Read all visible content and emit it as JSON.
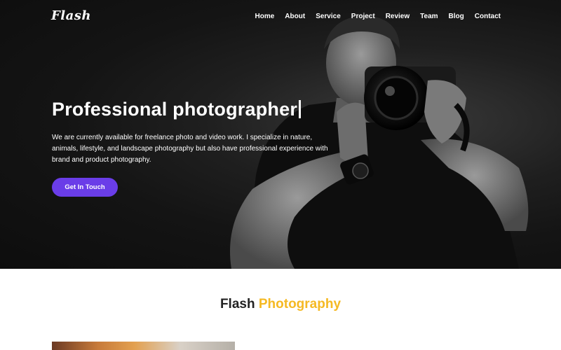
{
  "brand": {
    "logo_text": "Flash"
  },
  "nav": {
    "items": [
      "Home",
      "About",
      "Service",
      "Project",
      "Review",
      "Team",
      "Blog",
      "Contact"
    ]
  },
  "hero": {
    "title": "Professional photographer",
    "description": "We are currently available for freelance photo and video work. I specialize in nature, animals, lifestyle, and landscape photography but also have professional experience with brand and product photography.",
    "cta_label": "Get In Touch",
    "image": "photographer-holding-camera"
  },
  "section": {
    "title_part1": "Flash",
    "title_part2": "Photography"
  },
  "colors": {
    "accent_purple": "#6a3de8",
    "accent_yellow": "#f5b923",
    "hero_bg": "#141414",
    "heading_text": "#222222"
  }
}
